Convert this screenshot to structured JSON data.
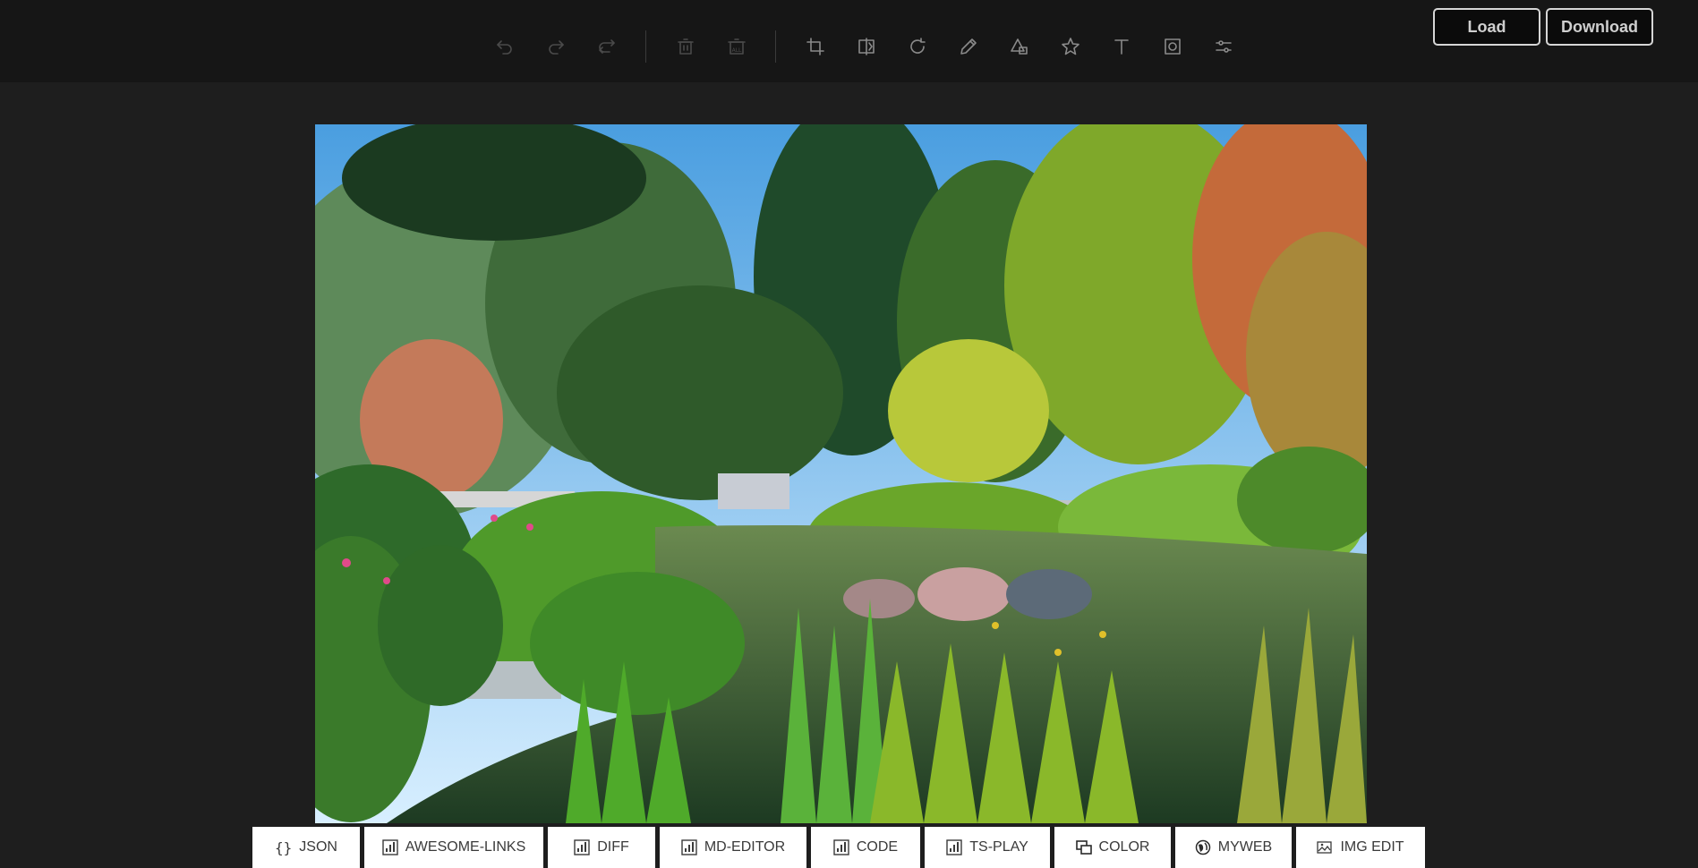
{
  "toolbar": {
    "items": [
      {
        "icon": "undo-icon",
        "enabled": false
      },
      {
        "icon": "redo-icon",
        "enabled": false
      },
      {
        "icon": "reset-icon",
        "enabled": false
      },
      {
        "icon": "delete-icon",
        "enabled": false
      },
      {
        "icon": "delete-all-icon",
        "enabled": false,
        "sublabel": "ALL"
      },
      {
        "icon": "crop-icon",
        "enabled": true
      },
      {
        "icon": "flip-icon",
        "enabled": true
      },
      {
        "icon": "rotate-icon",
        "enabled": true
      },
      {
        "icon": "draw-icon",
        "enabled": true
      },
      {
        "icon": "shape-icon",
        "enabled": true
      },
      {
        "icon": "icon-star-icon",
        "enabled": true
      },
      {
        "icon": "text-icon",
        "enabled": true
      },
      {
        "icon": "mask-icon",
        "enabled": true
      },
      {
        "icon": "filter-icon",
        "enabled": true
      }
    ]
  },
  "actions": {
    "load_label": "Load",
    "download_label": "Download"
  },
  "canvas": {
    "image_subject": "Japanese garden with pond, bridge and trees"
  },
  "bottom_tabs": [
    {
      "label": "JSON",
      "icon": "braces-icon"
    },
    {
      "label": "AWESOME-LINKS",
      "icon": "grid-icon"
    },
    {
      "label": "DIFF",
      "icon": "grid-icon"
    },
    {
      "label": "MD-EDITOR",
      "icon": "grid-icon"
    },
    {
      "label": "CODE",
      "icon": "grid-icon"
    },
    {
      "label": "TS-PLAY",
      "icon": "grid-icon"
    },
    {
      "label": "COLOR",
      "icon": "color-icon"
    },
    {
      "label": "MYWEB",
      "icon": "globe-icon"
    },
    {
      "label": "IMG EDIT",
      "icon": "image-edit-icon"
    }
  ],
  "colors": {
    "accent": "#ffffff",
    "background": "#1e1e1e",
    "topbar": "#161616"
  }
}
